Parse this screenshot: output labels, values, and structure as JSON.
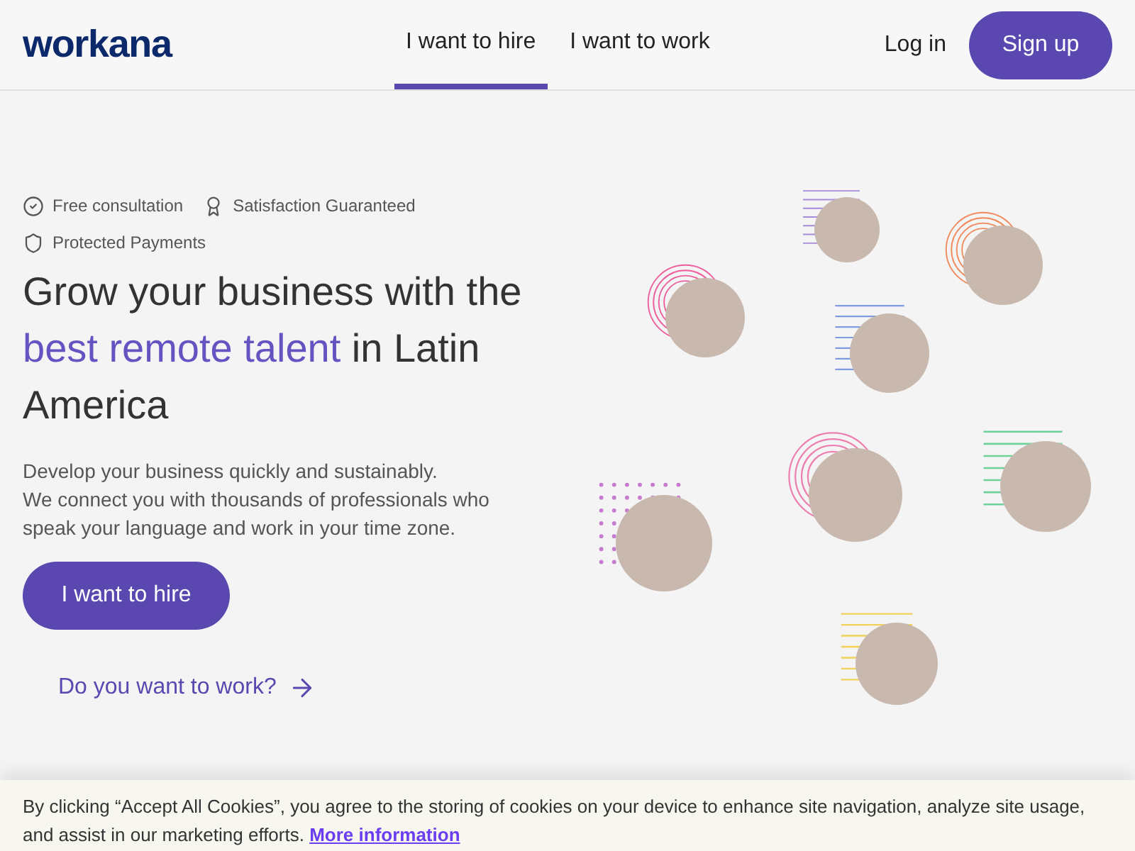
{
  "header": {
    "logo": "workana",
    "tabs": [
      {
        "label": "I want to hire",
        "selected": true
      },
      {
        "label": "I want to work",
        "selected": false
      }
    ],
    "login": "Log in",
    "signup": "Sign up"
  },
  "badges": [
    {
      "kind": "check",
      "label": "Free consultation"
    },
    {
      "kind": "award",
      "label": "Satisfaction Guaranteed"
    },
    {
      "kind": "shield",
      "label": "Protected Payments"
    }
  ],
  "headline": [
    {
      "text": "Grow your business with the ",
      "highlight": false
    },
    {
      "text": "best remote talent",
      "highlight": true
    },
    {
      "text": " in Latin America",
      "highlight": false
    }
  ],
  "intro": [
    "Develop your business quickly and sustainably.",
    "We connect you with thousands of professionals who speak your language and work in your time zone."
  ],
  "cta": "I want to hire",
  "work_link": "Do you want to work?",
  "cookie_banner": {
    "text": "By clicking “Accept All Cookies”, you agree to the storing of cookies on your device to enhance site navigation, analyze site usage, and assist in our marketing efforts.",
    "link": "More information"
  }
}
